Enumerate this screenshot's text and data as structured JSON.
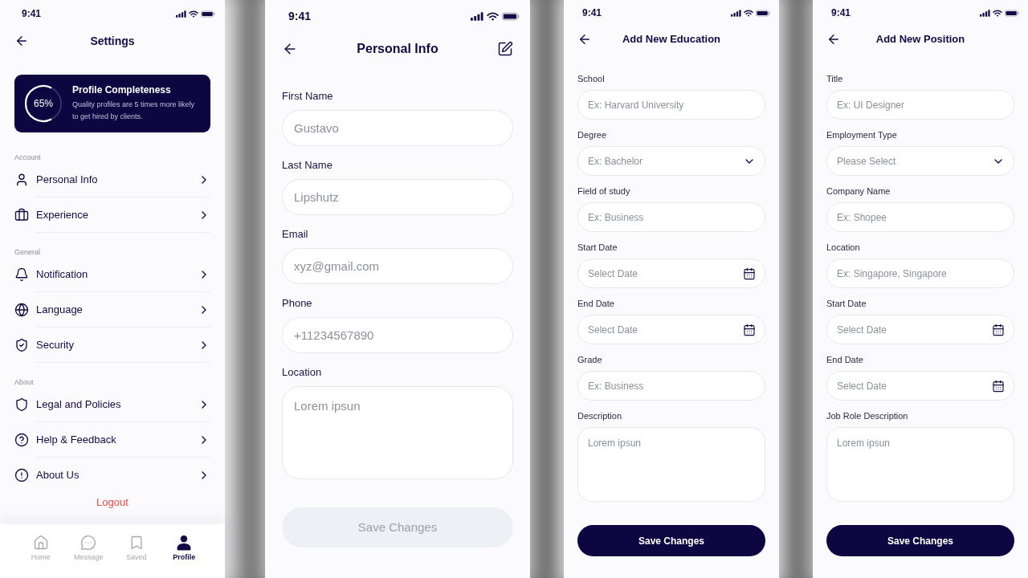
{
  "screens": [
    {
      "kind": "settings",
      "status_bar": {
        "time": "9:41"
      },
      "header": {
        "title": "Settings"
      },
      "profile_card": {
        "percent": "65%",
        "level": 0.65,
        "title": "Profile Completeness",
        "text": "Quality profiles are 5 times more likely to get hired by clients."
      },
      "sections": [
        {
          "title": "Account",
          "items": [
            {
              "label": "Personal Info"
            },
            {
              "label": "Experience"
            }
          ]
        },
        {
          "title": "General",
          "items": [
            {
              "label": "Notification"
            },
            {
              "label": "Language"
            },
            {
              "label": "Security"
            }
          ]
        },
        {
          "title": "About",
          "items": [
            {
              "label": "Legal and Policies"
            },
            {
              "label": "Help & Feedback"
            },
            {
              "label": "About Us"
            }
          ]
        }
      ],
      "logout": "Logout",
      "bottom_nav": [
        {
          "label": "Home",
          "selected": false
        },
        {
          "label": "Message",
          "selected": false
        },
        {
          "label": "Saved",
          "selected": false
        },
        {
          "label": "Profile",
          "selected": true
        }
      ]
    },
    {
      "kind": "profile_form",
      "status_bar": {
        "time": "9:41"
      },
      "header": {
        "title": "Personal Info"
      },
      "fields": [
        {
          "kind": "text",
          "label": "First Name",
          "placeholder": "Gustavo"
        },
        {
          "kind": "text",
          "label": "Last Name",
          "placeholder": "Lipshutz"
        },
        {
          "kind": "text",
          "label": "Email",
          "placeholder": "xyz@gmail.com"
        },
        {
          "kind": "text",
          "label": "Phone",
          "placeholder": "+11234567890"
        },
        {
          "kind": "textarea",
          "label": "Location",
          "placeholder": "Lorem ipsun"
        }
      ],
      "save_button": {
        "label": "Save Changes",
        "disabled": true
      }
    },
    {
      "kind": "entry_form",
      "status_bar": {
        "time": "9:41"
      },
      "header": {
        "title": "Add New Education"
      },
      "fields": [
        {
          "kind": "text",
          "label": "School",
          "placeholder": "Ex: Harvard University"
        },
        {
          "kind": "select",
          "label": "Degree",
          "placeholder": "Ex: Bachelor"
        },
        {
          "kind": "text",
          "label": "Field of study",
          "placeholder": "Ex: Business"
        },
        {
          "kind": "date",
          "label": "Start Date",
          "placeholder": "Select Date"
        },
        {
          "kind": "date",
          "label": "End Date",
          "placeholder": "Select Date"
        },
        {
          "kind": "text",
          "label": "Grade",
          "placeholder": "Ex: Business"
        },
        {
          "kind": "textarea",
          "label": "Description",
          "placeholder": "Lorem ipsun"
        }
      ],
      "save_button": {
        "label": "Save Changes",
        "disabled": false
      }
    },
    {
      "kind": "entry_form",
      "status_bar": {
        "time": "9:41"
      },
      "header": {
        "title": "Add New Position"
      },
      "fields": [
        {
          "kind": "text",
          "label": "Title",
          "placeholder": "Ex: UI Designer"
        },
        {
          "kind": "select",
          "label": "Employment Type",
          "placeholder": "Please Select"
        },
        {
          "kind": "text",
          "label": "Company Name",
          "placeholder": "Ex: Shopee"
        },
        {
          "kind": "text",
          "label": "Location",
          "placeholder": "Ex: Singapore, Singapore"
        },
        {
          "kind": "date",
          "label": "Start Date",
          "placeholder": "Select Date"
        },
        {
          "kind": "date",
          "label": "End Date",
          "placeholder": "Select Date"
        },
        {
          "kind": "textarea",
          "label": "Job Role Description",
          "placeholder": "Lorem ipsun"
        }
      ],
      "save_button": {
        "label": "Save Changes",
        "disabled": false
      }
    }
  ]
}
